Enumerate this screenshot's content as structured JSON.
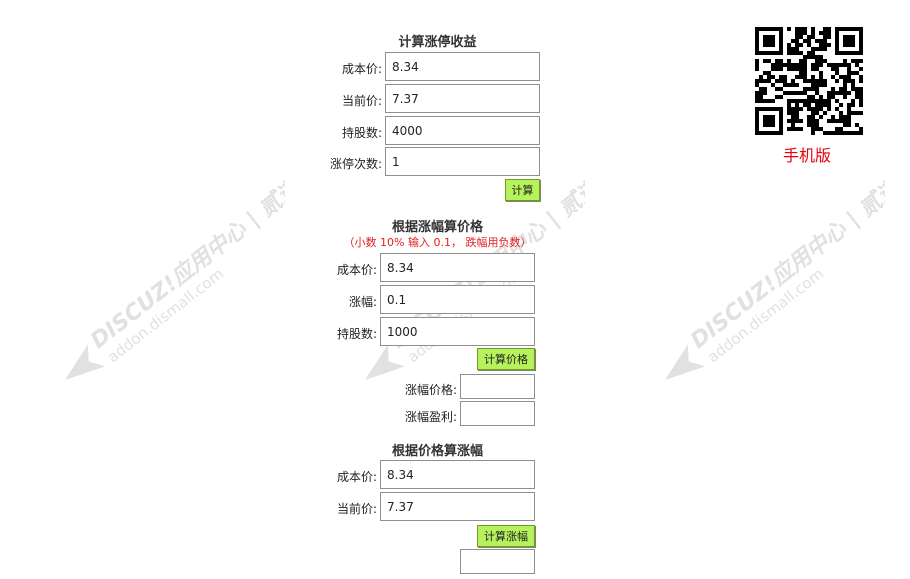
{
  "section1": {
    "title": "计算涨停收益",
    "cost_label": "成本价:",
    "cost_value": "8.34",
    "current_label": "当前价:",
    "current_value": "7.37",
    "shares_label": "持股数:",
    "shares_value": "4000",
    "times_label": "涨停次数:",
    "times_value": "1",
    "button": "计算"
  },
  "section2": {
    "title": "根据涨幅算价格",
    "note": "（小数 10% 输入 0.1， 跌幅用负数）",
    "cost_label": "成本价:",
    "cost_value": "8.34",
    "rise_label": "涨幅:",
    "rise_value": "0.1",
    "shares_label": "持股数:",
    "shares_value": "1000",
    "button": "计算价格",
    "price_result_label": "涨幅价格:",
    "price_result_value": "",
    "profit_result_label": "涨幅盈利:",
    "profit_result_value": ""
  },
  "section3": {
    "title": "根据价格算涨幅",
    "cost_label": "成本价:",
    "cost_value": "8.34",
    "current_label": "当前价:",
    "current_value": "7.37",
    "button": "计算涨幅",
    "result_value": ""
  },
  "qr": {
    "label": "手机版"
  },
  "watermark": {
    "text": "DISCUZ!应用中心 | 贰道",
    "sub": "addon.dismall.com"
  },
  "colors": {
    "button_bg": "#b6f25c",
    "note": "#e02020",
    "qr_label": "#e8000b"
  }
}
